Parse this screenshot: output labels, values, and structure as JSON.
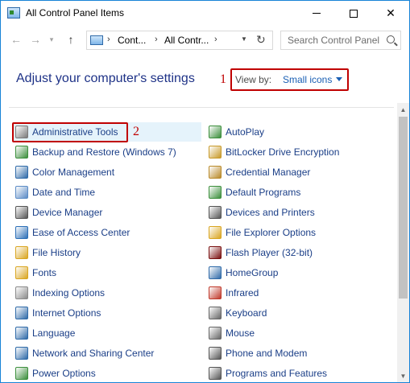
{
  "window": {
    "title": "All Control Panel Items"
  },
  "address": {
    "crumbs": [
      "Cont...",
      "All Contr..."
    ],
    "search_placeholder": "Search Control Panel"
  },
  "content": {
    "heading": "Adjust your computer's settings",
    "view_by_label": "View by:",
    "view_by_value": "Small icons",
    "annotation_1": "1",
    "annotation_2": "2"
  },
  "items_left": [
    {
      "label": "Administrative Tools",
      "icon": "admin-tools-icon",
      "color": "#7a7a7a"
    },
    {
      "label": "Backup and Restore (Windows 7)",
      "icon": "backup-icon",
      "color": "#3c8f3c"
    },
    {
      "label": "Color Management",
      "icon": "color-management-icon",
      "color": "#2f6aa8"
    },
    {
      "label": "Date and Time",
      "icon": "clock-icon",
      "color": "#5b8bc5"
    },
    {
      "label": "Device Manager",
      "icon": "device-manager-icon",
      "color": "#555555"
    },
    {
      "label": "Ease of Access Center",
      "icon": "ease-of-access-icon",
      "color": "#2c6fb7"
    },
    {
      "label": "File History",
      "icon": "file-history-icon",
      "color": "#d9a520"
    },
    {
      "label": "Fonts",
      "icon": "fonts-icon",
      "color": "#d9a520"
    },
    {
      "label": "Indexing Options",
      "icon": "indexing-icon",
      "color": "#8a8a8a"
    },
    {
      "label": "Internet Options",
      "icon": "internet-options-icon",
      "color": "#2f6aa8"
    },
    {
      "label": "Language",
      "icon": "language-icon",
      "color": "#2f6aa8"
    },
    {
      "label": "Network and Sharing Center",
      "icon": "network-icon",
      "color": "#2f6aa8"
    },
    {
      "label": "Power Options",
      "icon": "power-icon",
      "color": "#3c8f3c"
    }
  ],
  "items_right": [
    {
      "label": "AutoPlay",
      "icon": "autoplay-icon",
      "color": "#3c8f3c"
    },
    {
      "label": "BitLocker Drive Encryption",
      "icon": "bitlocker-icon",
      "color": "#c89a2a"
    },
    {
      "label": "Credential Manager",
      "icon": "credential-icon",
      "color": "#b98a2a"
    },
    {
      "label": "Default Programs",
      "icon": "default-programs-icon",
      "color": "#3c8f3c"
    },
    {
      "label": "Devices and Printers",
      "icon": "printer-icon",
      "color": "#555555"
    },
    {
      "label": "File Explorer Options",
      "icon": "folder-options-icon",
      "color": "#d9a520"
    },
    {
      "label": "Flash Player (32-bit)",
      "icon": "flash-icon",
      "color": "#7a1010"
    },
    {
      "label": "HomeGroup",
      "icon": "homegroup-icon",
      "color": "#2f6aa8"
    },
    {
      "label": "Infrared",
      "icon": "infrared-icon",
      "color": "#c0392b"
    },
    {
      "label": "Keyboard",
      "icon": "keyboard-icon",
      "color": "#666666"
    },
    {
      "label": "Mouse",
      "icon": "mouse-icon",
      "color": "#666666"
    },
    {
      "label": "Phone and Modem",
      "icon": "phone-icon",
      "color": "#555555"
    },
    {
      "label": "Programs and Features",
      "icon": "programs-icon",
      "color": "#555555"
    }
  ],
  "colors": {
    "accent": "#1883d7",
    "heading": "#1e3287",
    "link": "#1a3e87",
    "annotation": "#c00000",
    "highlight": "#e5f3fb"
  }
}
